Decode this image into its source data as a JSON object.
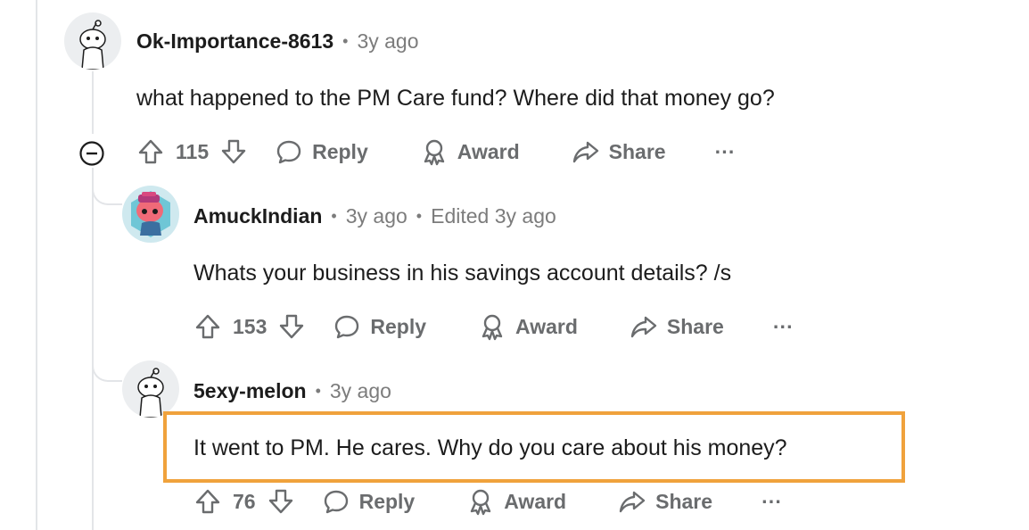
{
  "comments": [
    {
      "username": "Ok-Importance-8613",
      "time": "3y ago",
      "edited": "",
      "body": "what happened to the PM Care fund? Where did that money go?",
      "votes": "115",
      "reply_label": "Reply",
      "award_label": "Award",
      "share_label": "Share",
      "more_label": "···"
    },
    {
      "username": "AmuckIndian",
      "time": "3y ago",
      "edited": "Edited 3y ago",
      "body": "Whats your business in his savings account details? /s",
      "votes": "153",
      "reply_label": "Reply",
      "award_label": "Award",
      "share_label": "Share",
      "more_label": "···"
    },
    {
      "username": "5exy-melon",
      "time": "3y ago",
      "edited": "",
      "body": "It went to PM. He cares. Why do you care about his money?",
      "votes": "76",
      "reply_label": "Reply",
      "award_label": "Award",
      "share_label": "Share",
      "more_label": "···"
    }
  ],
  "colors": {
    "highlight_border": "#f0a23c",
    "muted_text": "#7c7c7c",
    "action_text": "#6a6c6e",
    "thread_line": "#e3e5e8"
  },
  "icons": [
    "upvote-icon",
    "downvote-icon",
    "reply-icon",
    "award-icon",
    "share-icon",
    "more-icon",
    "collapse-icon"
  ]
}
